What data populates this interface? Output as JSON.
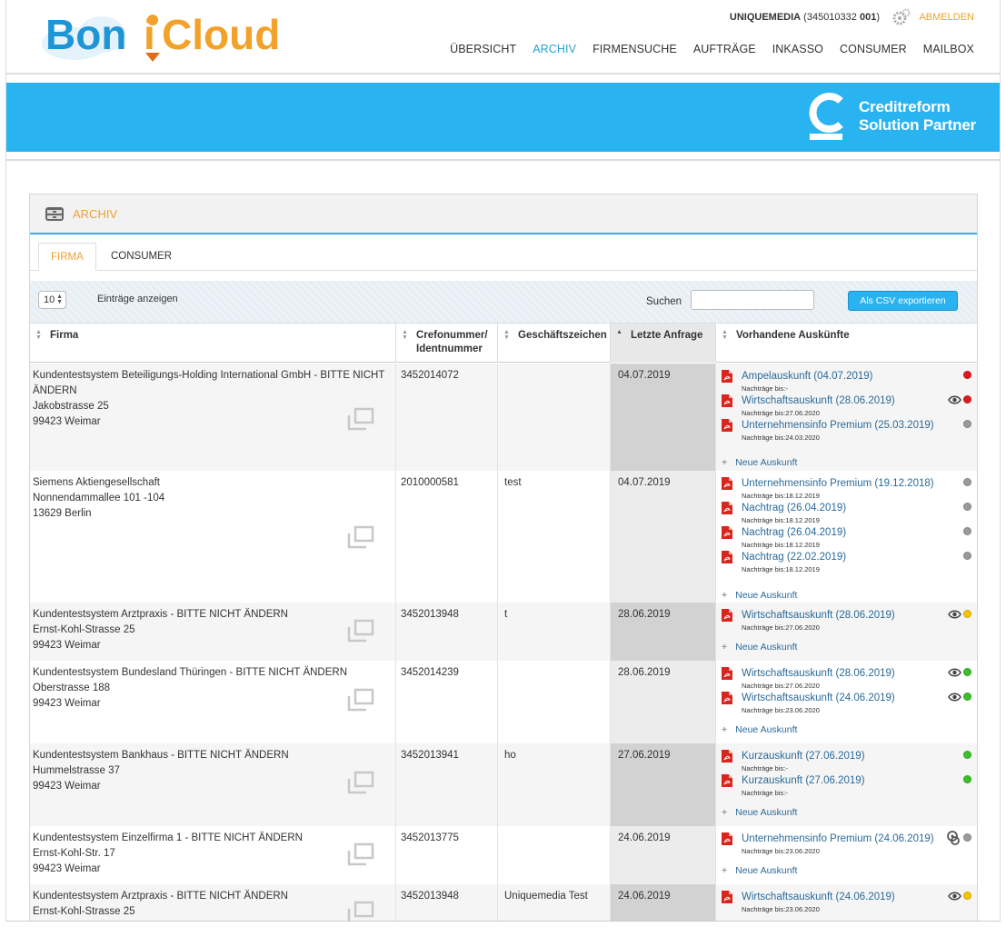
{
  "header": {
    "logo_text_a": "Bon",
    "logo_text_b": "Cloud",
    "user_name": "UNIQUEMEDIA",
    "user_id": "(345010332",
    "user_id_b": "001",
    "user_id_c": ")",
    "logout": "ABMELDEN",
    "nav": [
      {
        "label": "ÜBERSICHT",
        "active": false
      },
      {
        "label": "ARCHIV",
        "active": true
      },
      {
        "label": "FIRMENSUCHE",
        "active": false
      },
      {
        "label": "AUFTRÄGE",
        "active": false
      },
      {
        "label": "INKASSO",
        "active": false
      },
      {
        "label": "CONSUMER",
        "active": false
      },
      {
        "label": "MAILBOX",
        "active": false
      }
    ]
  },
  "banner": {
    "line1": "Creditreform",
    "line2": "Solution Partner",
    "color": "#2ab3f1"
  },
  "panel": {
    "title": "ARCHIV",
    "tabs": [
      {
        "label": "FIRMA",
        "active": true
      },
      {
        "label": "CONSUMER",
        "active": false
      }
    ],
    "page_size": "10",
    "entries_label": "Einträge anzeigen",
    "search_label": "Suchen",
    "search_value": "",
    "csv_button": "Als CSV exportieren"
  },
  "table": {
    "columns": [
      "Firma",
      "Crefonummer/ Identnummer",
      "Geschäftszeichen",
      "Letzte Anfrage",
      "Vorhandene Auskünfte"
    ],
    "new_report_label": "Neue Auskunft",
    "rows": [
      {
        "firma": [
          "Kundentestsystem Beteiligungs-Holding International GmbH - BITTE NICHT",
          "ÄNDERN",
          "Jakobstrasse 25",
          "99423 Weimar"
        ],
        "crefo": "3452014072",
        "gesch": "",
        "date": "04.07.2019",
        "reports": [
          {
            "title": "Ampelauskunft (04.07.2019)",
            "sub": "Nachträge bis:-",
            "eye": false,
            "status": "red"
          },
          {
            "title": "Wirtschaftsauskunft (28.06.2019)",
            "sub": "Nachträge bis:27.06.2020",
            "eye": true,
            "status": "red"
          },
          {
            "title": "Unternehmensinfo Premium (25.03.2019)",
            "sub": "Nachträge bis:24.03.2020",
            "eye": false,
            "status": "grey"
          }
        ]
      },
      {
        "firma": [
          "Siemens Aktiengesellschaft",
          "Nonnendammallee 101 -104",
          "13629 Berlin"
        ],
        "crefo": "2010000581",
        "gesch": "test",
        "date": "04.07.2019",
        "reports": [
          {
            "title": "Unternehmensinfo Premium (19.12.2018)",
            "sub": "Nachträge bis:18.12.2019",
            "eye": false,
            "status": "grey"
          },
          {
            "title": "Nachtrag (26.04.2019)",
            "sub": "Nachträge bis:18.12.2019",
            "eye": false,
            "status": "grey"
          },
          {
            "title": "Nachtrag (26.04.2019)",
            "sub": "Nachträge bis:18.12.2019",
            "eye": false,
            "status": "grey"
          },
          {
            "title": "Nachtrag (22.02.2019)",
            "sub": "Nachträge bis:18.12.2019",
            "eye": false,
            "status": "grey"
          }
        ]
      },
      {
        "firma": [
          "Kundentestsystem Arztpraxis - BITTE NICHT ÄNDERN",
          "Ernst-Kohl-Strasse 25",
          "99423 Weimar"
        ],
        "crefo": "3452013948",
        "gesch": "t",
        "date": "28.06.2019",
        "reports": [
          {
            "title": "Wirtschaftsauskunft (28.06.2019)",
            "sub": "Nachträge bis:27.06.2020",
            "eye": true,
            "status": "yellow"
          }
        ]
      },
      {
        "firma": [
          "Kundentestsystem Bundesland Thüringen - BITTE NICHT ÄNDERN",
          "Oberstrasse 188",
          "99423 Weimar"
        ],
        "crefo": "3452014239",
        "gesch": "",
        "date": "28.06.2019",
        "reports": [
          {
            "title": "Wirtschaftsauskunft (28.06.2019)",
            "sub": "Nachträge bis:27.06.2020",
            "eye": true,
            "status": "green"
          },
          {
            "title": "Wirtschaftsauskunft (24.06.2019)",
            "sub": "Nachträge bis:23.06.2020",
            "eye": true,
            "status": "green"
          }
        ]
      },
      {
        "firma": [
          "Kundentestsystem Bankhaus - BITTE NICHT ÄNDERN",
          "Hummelstrasse 37",
          "99423 Weimar"
        ],
        "crefo": "3452013941",
        "gesch": "ho",
        "date": "27.06.2019",
        "reports": [
          {
            "title": "Kurzauskunft (27.06.2019)",
            "sub": "Nachträge bis:-",
            "eye": false,
            "status": "green"
          },
          {
            "title": "Kurzauskunft (27.06.2019)",
            "sub": "Nachträge bis:-",
            "eye": false,
            "status": "green"
          }
        ]
      },
      {
        "firma": [
          "Kundentestsystem Einzelfirma 1 - BITTE NICHT ÄNDERN",
          "Ernst-Kohl-Str. 17",
          "99423 Weimar"
        ],
        "crefo": "3452013775",
        "gesch": "",
        "date": "24.06.2019",
        "reports": [
          {
            "title": "Unternehmensinfo Premium (24.06.2019)",
            "sub": "Nachträge bis:23.06.2020",
            "eye": false,
            "guard": true,
            "status": "grey"
          }
        ]
      },
      {
        "firma": [
          "Kundentestsystem Arztpraxis - BITTE NICHT ÄNDERN",
          "Ernst-Kohl-Strasse 25"
        ],
        "crefo": "3452013948",
        "gesch": "Uniquemedia Test",
        "date": "24.06.2019",
        "reports": [
          {
            "title": "Wirtschaftsauskunft (24.06.2019)",
            "sub": "Nachträge bis:23.06.2020",
            "eye": true,
            "status": "yellow"
          }
        ]
      }
    ]
  }
}
